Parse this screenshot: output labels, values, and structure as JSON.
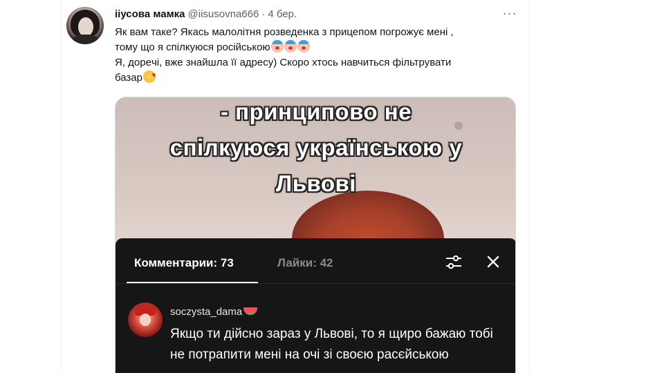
{
  "tweet": {
    "author_name": "ііусова мамка",
    "author_handle": "@iisusovna666",
    "separator": "·",
    "date": "4 бер.",
    "more_icon": "more-horizontal-icon",
    "text_line1": "Як вам таке? Якась малолітня розведенка з прицепом погрожує мені ,",
    "text_line2": "тому що я спілкуюся російською",
    "text_line2_emojis": [
      "clown-face",
      "clown-face",
      "clown-face"
    ],
    "text_line3": "Я, дорeчі, вже знайшла її адресу) Скоро хтось навчиться фільтрувати",
    "text_line4": "базар",
    "text_line4_emoji": "smiling-face-with-hearts"
  },
  "media": {
    "caption_line1": "- принципово не",
    "caption_line2": "спілкуюся українською у",
    "caption_line3": "Львові",
    "panel": {
      "comments_tab": "Комментарии: 73",
      "likes_tab": "Лайки: 42",
      "filter_icon": "sliders-icon",
      "close_icon": "close-icon",
      "comment": {
        "username": "soczysta_dama",
        "username_emoji": "watermelon",
        "text": "Якщо ти дійсно зараз у Львові, то я щиро бажаю тобі не потрапити мені на очі зі своєю расєйською"
      }
    }
  },
  "colors": {
    "text_primary": "#0f1419",
    "text_secondary": "#536471",
    "panel_bg": "#161616"
  }
}
